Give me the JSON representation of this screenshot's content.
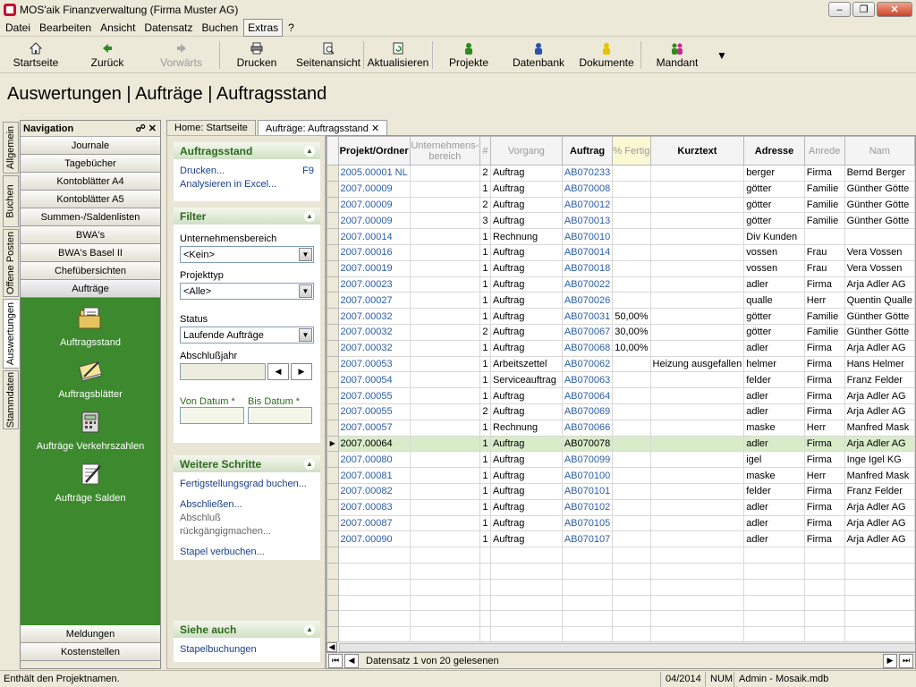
{
  "window": {
    "title": "MOS'aik Finanzverwaltung (Firma Muster AG)"
  },
  "menu": [
    "Datei",
    "Bearbeiten",
    "Ansicht",
    "Datensatz",
    "Buchen",
    "Extras",
    "?"
  ],
  "toolbar": {
    "start": "Startseite",
    "back": "Zurück",
    "forward": "Vorwärts",
    "print": "Drucken",
    "preview": "Seitenansicht",
    "refresh": "Aktualisieren",
    "projects": "Projekte",
    "database": "Datenbank",
    "documents": "Dokumente",
    "client": "Mandant"
  },
  "page": {
    "title": "Auswertungen | Aufträge | Auftragsstand"
  },
  "vtabs": [
    "Allgemein",
    "Buchen",
    "Offene Posten",
    "Auswertungen",
    "Stammdaten"
  ],
  "nav": {
    "title": "Navigation",
    "items_top": [
      "Journale",
      "Tagebücher",
      "Kontoblätter A4",
      "Kontoblätter A5",
      "Summen-/Saldenlisten",
      "BWA's",
      "BWA's Basel II",
      "Chefübersichten",
      "Aufträge"
    ],
    "green_items": [
      "Auftragsstand",
      "Auftragsblätter",
      "Aufträge Verkehrszahlen",
      "Aufträge Salden"
    ],
    "items_bottom": [
      "Meldungen",
      "Kostenstellen"
    ]
  },
  "tabs": [
    "Home: Startseite",
    "Aufträge: Auftragsstand"
  ],
  "tasks": {
    "section1": {
      "title": "Auftragsstand",
      "print": "Drucken...",
      "print_shortcut": "F9",
      "excel": "Analysieren in Excel..."
    },
    "filter": {
      "title": "Filter",
      "business_area_label": "Unternehmensbereich",
      "business_area_value": "<Kein>",
      "project_type_label": "Projekttyp",
      "project_type_value": "<Alle>",
      "status_label": "Status",
      "status_value": "Laufende Aufträge",
      "closing_year_label": "Abschlußjahr",
      "from_date_label": "Von Datum *",
      "to_date_label": "Bis Datum *"
    },
    "next_steps": {
      "title": "Weitere Schritte",
      "book_progress": "Fertigstellungsgrad buchen...",
      "close": "Abschließen...",
      "undo_close": "Abschluß rückgängigmachen...",
      "batch_book": "Stapel verbuchen..."
    },
    "see_also": {
      "title": "Siehe auch",
      "batch": "Stapelbuchungen"
    }
  },
  "grid": {
    "columns": [
      "Projekt/Ordner",
      "Unternehmens-bereich",
      "#",
      "Vorgang",
      "Auftrag",
      "% Fertig",
      "Kurztext",
      "Adresse",
      "Anrede",
      "Nam"
    ],
    "rows": [
      [
        "2005.00001 NL",
        "",
        "2",
        "Auftrag",
        "AB070233",
        "",
        "",
        "berger",
        "Firma",
        "Bernd Berger"
      ],
      [
        "2007.00009",
        "",
        "1",
        "Auftrag",
        "AB070008",
        "",
        "",
        "götter",
        "Familie",
        "Günther Götte"
      ],
      [
        "2007.00009",
        "",
        "2",
        "Auftrag",
        "AB070012",
        "",
        "",
        "götter",
        "Familie",
        "Günther Götte"
      ],
      [
        "2007.00009",
        "",
        "3",
        "Auftrag",
        "AB070013",
        "",
        "",
        "götter",
        "Familie",
        "Günther Götte"
      ],
      [
        "2007.00014",
        "",
        "1",
        "Rechnung",
        "AB070010",
        "",
        "",
        "Div Kunden",
        "",
        ""
      ],
      [
        "2007.00016",
        "",
        "1",
        "Auftrag",
        "AB070014",
        "",
        "",
        "vossen",
        "Frau",
        "Vera Vossen"
      ],
      [
        "2007.00019",
        "",
        "1",
        "Auftrag",
        "AB070018",
        "",
        "",
        "vossen",
        "Frau",
        "Vera Vossen"
      ],
      [
        "2007.00023",
        "",
        "1",
        "Auftrag",
        "AB070022",
        "",
        "",
        "adler",
        "Firma",
        "Arja Adler AG"
      ],
      [
        "2007.00027",
        "",
        "1",
        "Auftrag",
        "AB070026",
        "",
        "",
        "qualle",
        "Herr",
        "Quentin Qualle"
      ],
      [
        "2007.00032",
        "",
        "1",
        "Auftrag",
        "AB070031",
        "50,00%",
        "",
        "götter",
        "Familie",
        "Günther Götte"
      ],
      [
        "2007.00032",
        "",
        "2",
        "Auftrag",
        "AB070067",
        "30,00%",
        "",
        "götter",
        "Familie",
        "Günther Götte"
      ],
      [
        "2007.00032",
        "",
        "1",
        "Auftrag",
        "AB070068",
        "10,00%",
        "",
        "adler",
        "Firma",
        "Arja Adler AG"
      ],
      [
        "2007.00053",
        "",
        "1",
        "Arbeitszettel",
        "AB070062",
        "",
        "Heizung ausgefallen",
        "helmer",
        "Firma",
        "Hans Helmer"
      ],
      [
        "2007.00054",
        "",
        "1",
        "Serviceauftrag",
        "AB070063",
        "",
        "",
        "felder",
        "Firma",
        "Franz Felder"
      ],
      [
        "2007.00055",
        "",
        "1",
        "Auftrag",
        "AB070064",
        "",
        "",
        "adler",
        "Firma",
        "Arja Adler AG"
      ],
      [
        "2007.00055",
        "",
        "2",
        "Auftrag",
        "AB070069",
        "",
        "",
        "adler",
        "Firma",
        "Arja Adler AG"
      ],
      [
        "2007.00057",
        "",
        "1",
        "Rechnung",
        "AB070066",
        "",
        "",
        "maske",
        "Herr",
        "Manfred Mask"
      ],
      [
        "2007.00064",
        "",
        "1",
        "Auftrag",
        "AB070078",
        "",
        "",
        "adler",
        "Firma",
        "Arja Adler AG"
      ],
      [
        "2007.00080",
        "",
        "1",
        "Auftrag",
        "AB070099",
        "",
        "",
        "igel",
        "Firma",
        "Inge Igel KG"
      ],
      [
        "2007.00081",
        "",
        "1",
        "Auftrag",
        "AB070100",
        "",
        "",
        "maske",
        "Herr",
        "Manfred Mask"
      ],
      [
        "2007.00082",
        "",
        "1",
        "Auftrag",
        "AB070101",
        "",
        "",
        "felder",
        "Firma",
        "Franz Felder"
      ],
      [
        "2007.00083",
        "",
        "1",
        "Auftrag",
        "AB070102",
        "",
        "",
        "adler",
        "Firma",
        "Arja Adler AG"
      ],
      [
        "2007.00087",
        "",
        "1",
        "Auftrag",
        "AB070105",
        "",
        "",
        "adler",
        "Firma",
        "Arja Adler AG"
      ],
      [
        "2007.00090",
        "",
        "1",
        "Auftrag",
        "AB070107",
        "",
        "",
        "adler",
        "Firma",
        "Arja Adler AG"
      ]
    ],
    "current_row": 17,
    "record_text": "Datensatz 1 von 20 gelesenen"
  },
  "status": {
    "hint": "Enthält den Projektnamen.",
    "period": "04/2014",
    "num": "NUM",
    "user": "Admin - Mosaik.mdb"
  }
}
